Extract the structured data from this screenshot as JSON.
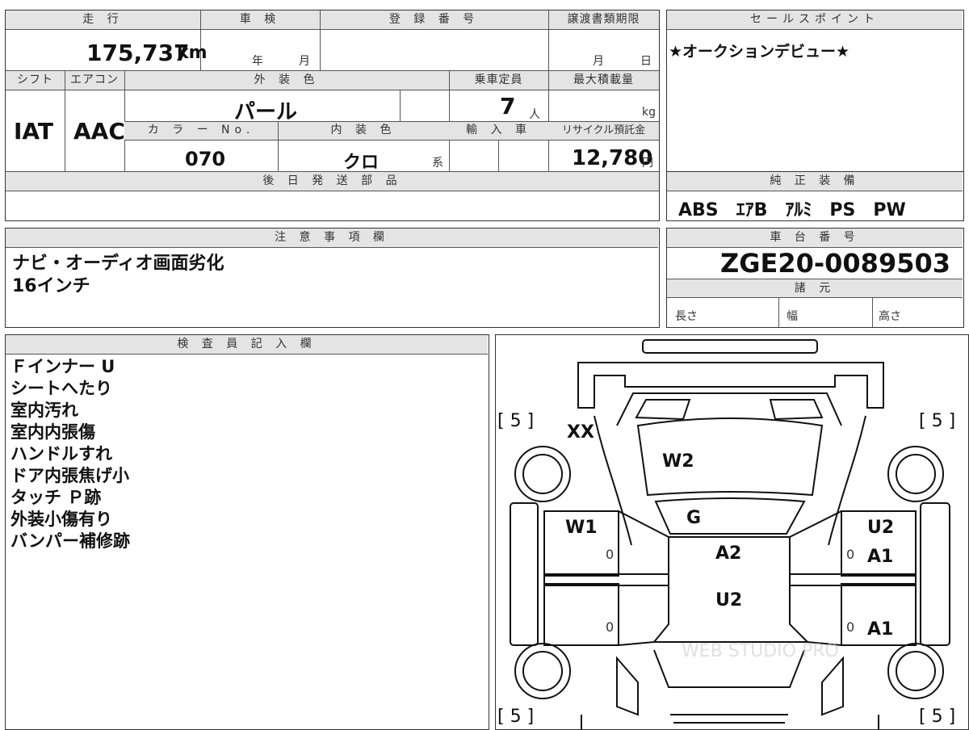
{
  "spec": {
    "headers": {
      "mileage": "走 行",
      "shaken": "車 検",
      "registration": "登 録 番 号",
      "transfer_deadline": "譲渡書類期限",
      "shift": "シフト",
      "aircon": "エアコン",
      "exterior_color": "外 装 色",
      "capacity": "乗車定員",
      "max_load": "最大積載量",
      "color_no": "カ ラ ー No.",
      "interior_color": "内 装 色",
      "import": "輸 入 車",
      "recycle": "リサイクル預託金",
      "later_parts": "後 日 発 送 部 品"
    },
    "mileage": "175,737",
    "mileage_unit": "km",
    "year_label": "年",
    "month_label": "月",
    "day_label": "日",
    "shift": "IAT",
    "aircon": "AAC",
    "exterior_color": "パール",
    "capacity": "7",
    "capacity_unit": "人",
    "load_unit": "kg",
    "color_no": "070",
    "interior_color": "クロ",
    "interior_suffix": "系",
    "recycle": "12,780",
    "yen": "円"
  },
  "sales": {
    "header": "セールスポイント",
    "text": "★オークションデビュー★"
  },
  "equipment": {
    "header": "純 正 装 備",
    "text": "ABS　ｴｱB　ｱﾙﾐ　PS　PW"
  },
  "notes": {
    "header": "注 意 事 項 欄",
    "lines": [
      "ナビ・オーディオ画面劣化",
      "16インチ"
    ]
  },
  "chassis": {
    "header": "車 台 番 号",
    "number": "ZGE20-0089503",
    "dims_header": "諸 元",
    "length": "長さ",
    "width": "幅",
    "height": "高さ"
  },
  "inspector": {
    "header": "検 査 員 記 入 欄",
    "lines": [
      "Ｆインナー U",
      "シートへたり",
      "室内汚れ",
      "室内内張傷",
      "ハンドルすれ",
      "ドア内張焦げ小",
      "タッチ Ｐ跡",
      "外装小傷有り",
      "バンパー補修跡"
    ]
  },
  "diagram": {
    "marks": {
      "tire_fl": "[ 5 ]",
      "tire_fr": "[ 5 ]",
      "tire_rl": "[ 5 ]",
      "tire_rr": "[ 5 ]",
      "hood": "XX",
      "windshield": "W2",
      "front_glass": "G",
      "roof_1": "A2",
      "roof_2": "U2",
      "left_front_window": "W1",
      "right_front_door": "U2",
      "right_front_door_2": "A1",
      "right_rear_door": "A1",
      "lf_door_code": "0",
      "lr_door_code": "0",
      "rf_door_code": "0",
      "rr_door_code": "0"
    },
    "watermark": "WEB STUDIO PRO"
  }
}
